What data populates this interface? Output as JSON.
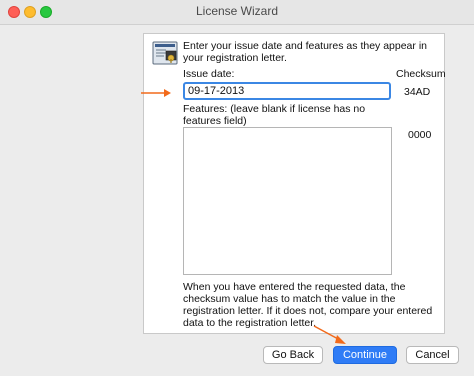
{
  "window": {
    "title": "License Wizard"
  },
  "icons": {
    "close": "close-traffic-light",
    "minimize": "minimize-traffic-light",
    "maximize": "maximize-traffic-light",
    "wizard": "license-wizard-icon",
    "arrow": "orange-annotation-arrow"
  },
  "form": {
    "intro": "Enter your issue date and features as they appear in your registration letter.",
    "issue_label": "Issue date:",
    "checksum_label": "Checksum",
    "issue_value": "09-17-2013",
    "issue_checksum": "34AD",
    "features_label": "Features: (leave blank if license has no features field)",
    "features_checksum": "0000",
    "features_value": "",
    "bottom_text": "When you have entered the requested data, the checksum value has to match the value in the registration letter.  If it does not, compare your entered data to the registration letter."
  },
  "buttons": {
    "back": "Go Back",
    "continue": "Continue",
    "cancel": "Cancel"
  },
  "colors": {
    "accent": "#2f7cf6",
    "focus_ring": "#3b87e4",
    "annotation": "#f26a1b"
  }
}
